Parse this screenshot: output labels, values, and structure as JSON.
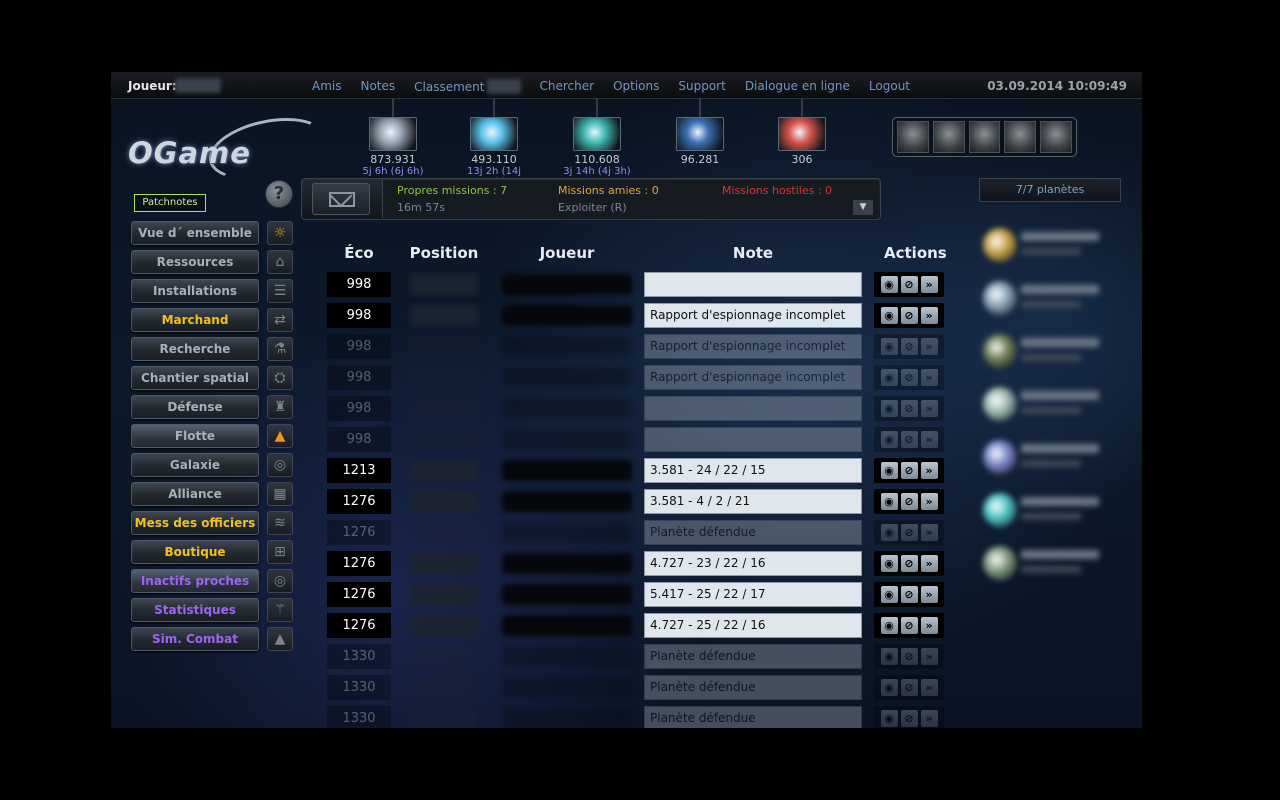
{
  "topbar": {
    "player_label": "Joueur:",
    "nav": [
      "Amis",
      "Notes",
      "Classement",
      "Chercher",
      "Options",
      "Support",
      "Dialogue en ligne",
      "Logout"
    ],
    "datetime": "03.09.2014 10:09:49"
  },
  "logo": {
    "text": "OGame"
  },
  "resources": [
    {
      "name": "metal",
      "value": "873.931",
      "sub": "5j 6h (6j 6h)",
      "color": "#9aa7b3"
    },
    {
      "name": "crystal",
      "value": "493.110",
      "sub": "13j 2h (14j 10h)",
      "color": "#59c2e8"
    },
    {
      "name": "deuterium",
      "value": "110.608",
      "sub": "3j 14h (4j 3h)",
      "color": "#3fb9b0"
    },
    {
      "name": "darkmatter",
      "value": "96.281",
      "sub": "",
      "color": "#3b6fb5"
    },
    {
      "name": "energy",
      "value": "306",
      "sub": "",
      "color": "#d9554c"
    }
  ],
  "patchnotes": "Patchnotes",
  "help": "?",
  "missions": {
    "own": "Propres missions : 7",
    "friend": "Missions amies : 0",
    "hostile": "Missions hostiles : 0",
    "timer": "16m 57s",
    "type": "Exploiter (R)"
  },
  "planets_header": "7/7 planètes",
  "menu": [
    {
      "label": "Vue d´ ensemble",
      "style": "",
      "icon": "☼",
      "icon_style": "orange",
      "icon_name": "overview-icon"
    },
    {
      "label": "Ressources",
      "style": "",
      "icon": "⌂",
      "icon_style": "",
      "icon_name": "resources-icon"
    },
    {
      "label": "Installations",
      "style": "",
      "icon": "☰",
      "icon_style": "",
      "icon_name": "facilities-icon"
    },
    {
      "label": "Marchand",
      "style": "yellow",
      "icon": "⇄",
      "icon_style": "",
      "icon_name": "trader-icon"
    },
    {
      "label": "Recherche",
      "style": "",
      "icon": "⚗",
      "icon_style": "",
      "icon_name": "research-icon"
    },
    {
      "label": "Chantier spatial",
      "style": "",
      "icon": "⛭",
      "icon_style": "",
      "icon_name": "shipyard-icon"
    },
    {
      "label": "Défense",
      "style": "",
      "icon": "♜",
      "icon_style": "",
      "icon_name": "defense-icon"
    },
    {
      "label": "Flotte",
      "style": "active",
      "icon": "▲",
      "icon_style": "orange",
      "icon_name": "fleet-icon"
    },
    {
      "label": "Galaxie",
      "style": "",
      "icon": "◎",
      "icon_style": "",
      "icon_name": "galaxy-icon"
    },
    {
      "label": "Alliance",
      "style": "",
      "icon": "▦",
      "icon_style": "",
      "icon_name": "alliance-icon"
    },
    {
      "label": "Mess des officiers",
      "style": "yellow",
      "icon": "≋",
      "icon_style": "",
      "icon_name": "officers-icon"
    },
    {
      "label": "Boutique",
      "style": "yellow",
      "icon": "⊞",
      "icon_style": "",
      "icon_name": "shop-icon"
    },
    {
      "label": "Inactifs proches",
      "style": "purple active",
      "icon": "◎",
      "icon_style": "",
      "icon_name": "inactives-icon"
    },
    {
      "label": "Statistiques",
      "style": "purple",
      "icon": "⚚",
      "icon_style": "",
      "icon_name": "statistics-icon"
    },
    {
      "label": "Sim. Combat",
      "style": "purple",
      "icon": "▲",
      "icon_style": "",
      "icon_name": "combat-sim-icon"
    }
  ],
  "table": {
    "headers": {
      "eco": "Éco",
      "position": "Position",
      "player": "Joueur",
      "note": "Note",
      "actions": "Actions"
    },
    "rows": [
      {
        "eco": "998",
        "note": "",
        "faded": false
      },
      {
        "eco": "998",
        "note": "Rapport d'espionnage incomplet",
        "faded": false
      },
      {
        "eco": "998",
        "note": "Rapport d'espionnage incomplet",
        "faded": true
      },
      {
        "eco": "998",
        "note": "Rapport d'espionnage incomplet",
        "faded": true
      },
      {
        "eco": "998",
        "note": "",
        "faded": true
      },
      {
        "eco": "998",
        "note": "",
        "faded": true
      },
      {
        "eco": "1213",
        "note": "3.581 - 24 / 22 / 15",
        "faded": false
      },
      {
        "eco": "1276",
        "note": "3.581 - 4 / 2 / 21",
        "faded": false
      },
      {
        "eco": "1276",
        "note": "Planète défendue",
        "faded": true
      },
      {
        "eco": "1276",
        "note": "4.727 - 23 / 22 / 16",
        "faded": false
      },
      {
        "eco": "1276",
        "note": "5.417 - 25 / 22 / 17",
        "faded": false
      },
      {
        "eco": "1276",
        "note": "4.727 - 25 / 22 / 16",
        "faded": false
      },
      {
        "eco": "1330",
        "note": "Planète défendue",
        "faded": true
      },
      {
        "eco": "1330",
        "note": "Planète défendue",
        "faded": true
      },
      {
        "eco": "1330",
        "note": "Planète défendue",
        "faded": true
      }
    ]
  },
  "planets": [
    {
      "color": "#c9a24a"
    },
    {
      "color": "#8aa3b8"
    },
    {
      "color": "#6f7f55"
    },
    {
      "color": "#9fb8b0"
    },
    {
      "color": "#7a86c8"
    },
    {
      "color": "#4ec3c6"
    },
    {
      "color": "#7f9b7f"
    }
  ]
}
